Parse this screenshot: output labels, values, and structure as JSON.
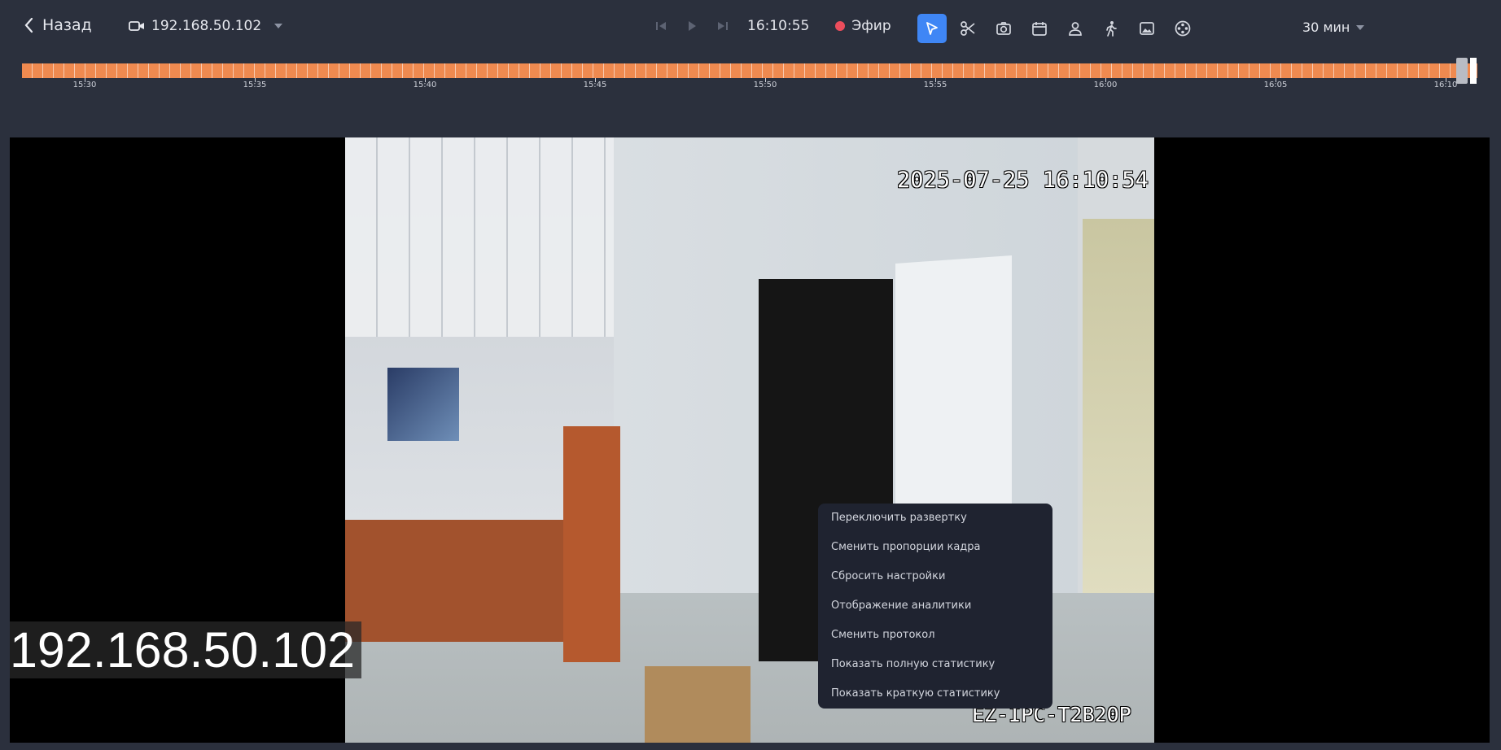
{
  "header": {
    "back_label": "Назад",
    "camera_select": "192.168.50.102",
    "current_time": "16:10:55",
    "live_label": "Эфир",
    "range_label": "30 мин"
  },
  "toolbar": {
    "icons": [
      "pointer-icon",
      "scissors-icon",
      "camera-icon",
      "calendar-icon",
      "person-icon",
      "walking-person-icon",
      "image-icon",
      "film-reel-icon"
    ],
    "active_tool": "pointer-icon"
  },
  "timeline": {
    "tick_labels": [
      "15:30",
      "15:35",
      "15:40",
      "15:45",
      "15:50",
      "15:55",
      "16:00",
      "16:05",
      "16:10"
    ],
    "color": "#ef8a50"
  },
  "video": {
    "timestamp_overlay": "2025-07-25 16:10:54",
    "model_overlay": "EZ-IPC-T2B20P",
    "camera_name_overlay": "192.168.50.102"
  },
  "context_menu": {
    "items": [
      "Переключить развертку",
      "Сменить пропорции кадра",
      "Сбросить настройки",
      "Отображение аналитики",
      "Сменить протокол",
      "Показать полную статистику",
      "Показать краткую статистику"
    ]
  },
  "colors": {
    "background": "#2b303d",
    "accent": "#3f86f5",
    "live_dot": "#ec4d5c",
    "menu_bg": "#1f2330"
  }
}
